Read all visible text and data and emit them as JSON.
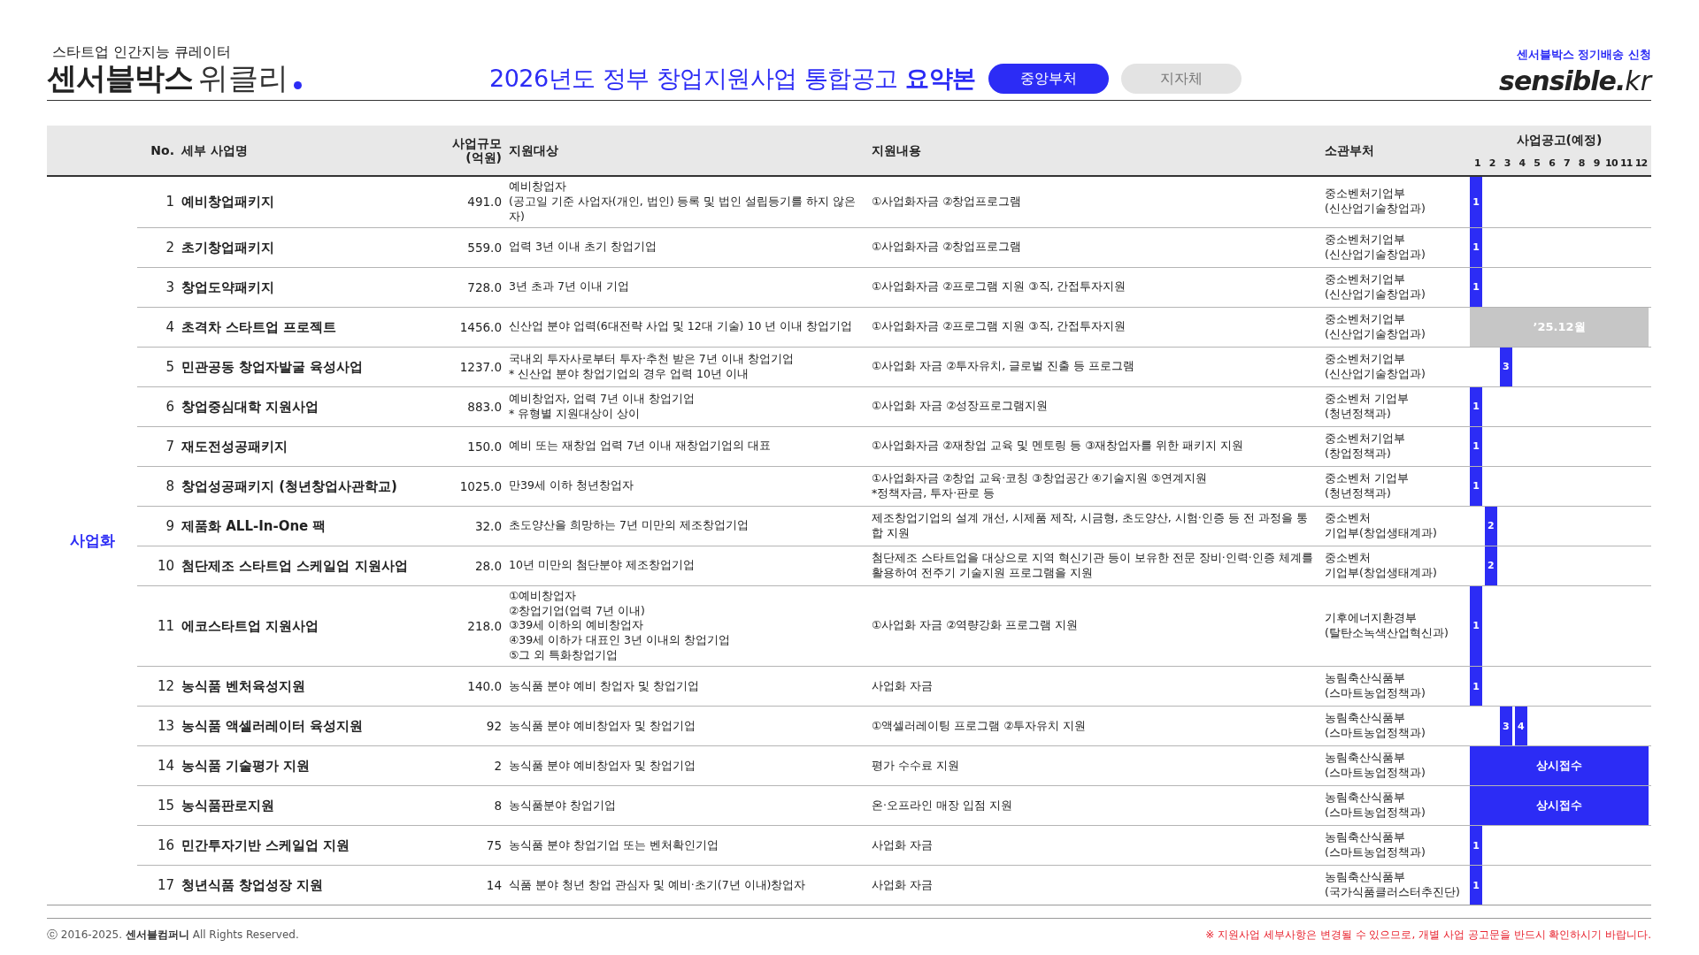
{
  "brand": {
    "tagline": "스타트업 인간지능 큐레이터",
    "name": "센서블박스",
    "suffix": "위클리"
  },
  "title": {
    "main": "2026년도 정부 창업지원사업 통합공고",
    "strong": "요약본"
  },
  "tabs": [
    {
      "label": "중앙부처",
      "selected": true
    },
    {
      "label": "지자체",
      "selected": false
    }
  ],
  "subscribe_link": "센서블박스 정기배송 신청",
  "logo": {
    "main": "sensible.",
    "suffix": "kr"
  },
  "columns": {
    "no": "No.",
    "name": "세부 사업명",
    "scale": "사업규모\n(억원)",
    "target": "지원대상",
    "content": "지원내용",
    "dept": "소관부처",
    "schedule": "사업공고(예정)"
  },
  "months": [
    "1",
    "2",
    "3",
    "4",
    "5",
    "6",
    "7",
    "8",
    "9",
    "10",
    "11",
    "12"
  ],
  "category": "사업화",
  "rows": [
    {
      "no": "1",
      "name": "예비창업패키지",
      "scale": "491.0",
      "target": "예비창업자\n(공고일 기준 사업자(개인, 법인) 등록 및 법인 설립등기를 하지 않은 자)",
      "content": "①사업화자금 ②창업프로그램",
      "dept": "중소벤처기업부\n(신산업기술창업과)",
      "schedule": {
        "kind": "months",
        "marks": [
          "1"
        ]
      }
    },
    {
      "no": "2",
      "name": "초기창업패키지",
      "scale": "559.0",
      "target": "업력 3년 이내 초기 창업기업",
      "content": "①사업화자금 ②창업프로그램",
      "dept": "중소벤처기업부\n(신산업기술창업과)",
      "schedule": {
        "kind": "months",
        "marks": [
          "1"
        ]
      }
    },
    {
      "no": "3",
      "name": "창업도약패키지",
      "scale": "728.0",
      "target": "3년 초과 7년 이내 기업",
      "content": "①사업화자금 ②프로그램 지원 ③직, 간접투자지원",
      "dept": "중소벤처기업부\n(신산업기술창업과)",
      "schedule": {
        "kind": "months",
        "marks": [
          "1"
        ]
      }
    },
    {
      "no": "4",
      "name": "초격차 스타트업 프로젝트",
      "scale": "1456.0",
      "target": "신산업 분야 업력(6대전략 사업 및 12대 기술) 10 년 이내 창업기업",
      "content": "①사업화자금 ②프로그램 지원 ③직, 간접투자지원",
      "dept": "중소벤처기업부\n(신산업기술창업과)",
      "schedule": {
        "kind": "span",
        "label": "’25.12월",
        "color": "#c6c6c6"
      }
    },
    {
      "no": "5",
      "name": "민관공동 창업자발굴 육성사업",
      "scale": "1237.0",
      "target": "국내외 투자사로부터 투자·추천 받은 7년 이내 창업기업\n * 신산업 분야 창업기업의 경우 업력 10년 이내",
      "content": "①사업화 자금 ②투자유치, 글로벌 진출 등 프로그램",
      "dept": "중소벤처기업부\n(신산업기술창업과)",
      "schedule": {
        "kind": "months",
        "marks": [
          "3"
        ]
      }
    },
    {
      "no": "6",
      "name": "창업중심대학 지원사업",
      "scale": "883.0",
      "target": "예비창업자, 업력 7년 이내 창업기업\n * 유형별 지원대상이 상이",
      "content": "①사업화 자금 ②성장프로그램지원",
      "dept": "중소벤처 기업부\n(청년정책과)",
      "schedule": {
        "kind": "months",
        "marks": [
          "1"
        ]
      }
    },
    {
      "no": "7",
      "name": "재도전성공패키지",
      "scale": "150.0",
      "target": "예비 또는 재창업 업력 7년 이내 재창업기업의 대표",
      "content": "①사업화자금 ②재창업 교육 및 멘토링 등 ③재창업자를 위한 패키지 지원",
      "dept": "중소벤처기업부\n(창업정책과)",
      "schedule": {
        "kind": "months",
        "marks": [
          "1"
        ]
      }
    },
    {
      "no": "8",
      "name": "창업성공패키지 (청년창업사관학교)",
      "scale": "1025.0",
      "target": "만39세 이하 청년창업자",
      "content": "①사업화자금 ②창업 교육·코칭 ③창업공간 ④기술지원 ⑤연계지원\n*정책자금, 투자·판로 등",
      "dept": "중소벤처 기업부\n(청년정책과)",
      "schedule": {
        "kind": "months",
        "marks": [
          "1"
        ]
      }
    },
    {
      "no": "9",
      "name": "제품화 ALL-In-One 팩",
      "scale": "32.0",
      "target": "초도양산을 희망하는 7년 미만의 제조창업기업",
      "content": "제조창업기업의 설계 개선, 시제품 제작, 시금형, 초도양산, 시험·인증 등 전 과정을 통\n합 지원",
      "dept": "중소벤처\n기업부(창업생태계과)",
      "schedule": {
        "kind": "months",
        "marks": [
          "2"
        ]
      }
    },
    {
      "no": "10",
      "name": "첨단제조 스타트업 스케일업 지원사업",
      "scale": "28.0",
      "target": "10년 미만의 첨단분야 제조창업기업",
      "content": "첨단제조 스타트업을 대상으로 지역 혁신기관 등이 보유한 전문 장비·인력·인증 체계를\n활용하여 전주기 기술지원 프로그램을 지원",
      "dept": "중소벤처\n기업부(창업생태계과)",
      "schedule": {
        "kind": "months",
        "marks": [
          "2"
        ]
      }
    },
    {
      "no": "11",
      "name": "에코스타트업 지원사업",
      "scale": "218.0",
      "target": "①예비창업자\n②창업기업(업력 7년 이내)\n③39세 이하의 예비창업자\n④39세 이하가 대표인 3년 이내의 창업기업\n⑤그 외 특화창업기업",
      "content": "①사업화 자금 ②역량강화 프로그램 지원",
      "dept": "기후에너지환경부\n(탈탄소녹색산업혁신과)",
      "schedule": {
        "kind": "months",
        "marks": [
          "1"
        ]
      }
    },
    {
      "no": "12",
      "name": "농식품 벤처육성지원",
      "scale": "140.0",
      "target": "농식품 분야 예비 창업자 및 창업기업",
      "content": "사업화 자금",
      "dept": "농림축산식품부\n(스마트농업정책과)",
      "schedule": {
        "kind": "months",
        "marks": [
          "1"
        ]
      }
    },
    {
      "no": "13",
      "name": "농식품 액셀러레이터 육성지원",
      "scale": "92",
      "target": "농식품 분야 예비창업자 및 창업기업",
      "content": "①액셀러레이팅 프로그램 ②투자유치 지원",
      "dept": "농림축산식품부\n(스마트농업정책과)",
      "schedule": {
        "kind": "months",
        "marks": [
          "3",
          "4"
        ]
      }
    },
    {
      "no": "14",
      "name": "농식품 기술평가 지원",
      "scale": "2",
      "target": "농식품 분야 예비창업자 및 창업기업",
      "content": "평가 수수료 지원",
      "dept": "농림축산식품부\n(스마트농업정책과)",
      "schedule": {
        "kind": "span",
        "label": "상시접수",
        "color": "#2c2cf5"
      }
    },
    {
      "no": "15",
      "name": "농식품판로지원",
      "scale": "8",
      "target": "농식품분야 창업기업",
      "content": "온·오프라인 매장 입점 지원",
      "dept": "농림축산식품부\n(스마트농업정책과)",
      "schedule": {
        "kind": "span",
        "label": "상시접수",
        "color": "#2c2cf5"
      }
    },
    {
      "no": "16",
      "name": "민간투자기반 스케일업 지원",
      "scale": "75",
      "target": "농식품 분야  창업기업 또는 벤처확인기업",
      "content": "사업화 자금",
      "dept": "농림축산식품부\n(스마트농업정책과)",
      "schedule": {
        "kind": "months",
        "marks": [
          "1"
        ]
      }
    },
    {
      "no": "17",
      "name": "청년식품 창업성장 지원",
      "scale": "14",
      "target": "식품 분야 청년 창업 관심자 및 예비·초기(7년 이내)창업자",
      "content": "사업화 자금",
      "dept": "농림축산식품부\n(국가식품클러스터추진단)",
      "schedule": {
        "kind": "months",
        "marks": [
          "1"
        ]
      }
    }
  ],
  "footer": {
    "copyright": "ⓒ 2016-2025. **센서블컴퍼니** All Rights Reserved.",
    "notice": "※ 지원사업 세부사항은 변경될 수 있으므로, 개별 사업 공고문을 반드시 확인하시기 바랍니다."
  }
}
